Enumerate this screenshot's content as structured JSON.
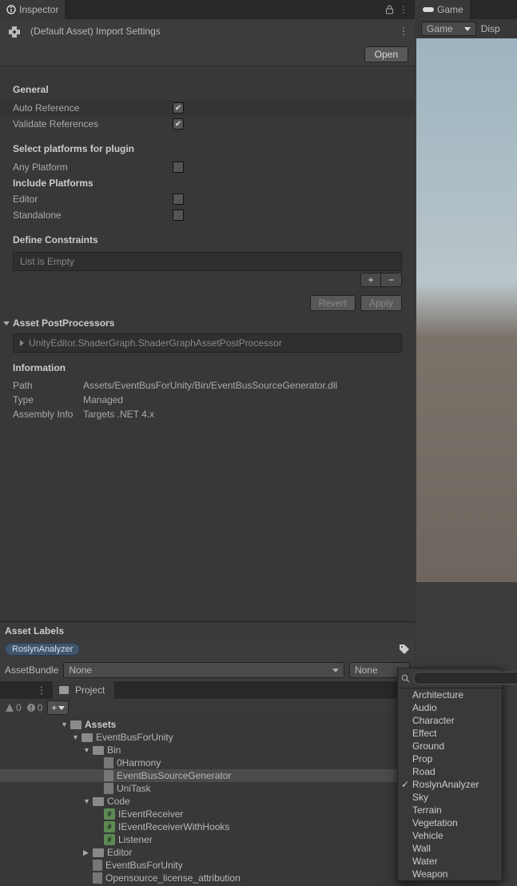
{
  "tabs": {
    "inspector": "Inspector",
    "game": "Game",
    "display": "Disp"
  },
  "header": {
    "title": "(Default Asset) Import Settings",
    "open": "Open"
  },
  "general": {
    "title": "General",
    "auto_ref": "Auto Reference",
    "validate": "Validate References"
  },
  "platforms": {
    "title": "Select platforms for plugin",
    "any": "Any Platform",
    "include": "Include Platforms",
    "editor": "Editor",
    "standalone": "Standalone"
  },
  "define": {
    "title": "Define Constraints",
    "empty": "List is Empty"
  },
  "actions": {
    "revert": "Revert",
    "apply": "Apply"
  },
  "post": {
    "title": "Asset PostProcessors",
    "item": "UnityEditor.ShaderGraph.ShaderGraphAssetPostProcessor"
  },
  "info": {
    "title": "Information",
    "path_k": "Path",
    "path_v": "Assets/EventBusForUnity/Bin/EventBusSourceGenerator.dll",
    "type_k": "Type",
    "type_v": "Managed",
    "asm_k": "Assembly Info",
    "asm_v": "Targets .NET 4.x"
  },
  "labels": {
    "title": "Asset Labels",
    "tag": "RoslynAnalyzer",
    "bundle": "AssetBundle",
    "none": "None"
  },
  "project": {
    "tab": "Project",
    "warn_count": "0",
    "err_count": "0",
    "tree": {
      "assets": "Assets",
      "ebfu": "EventBusForUnity",
      "bin": "Bin",
      "harmony": "0Harmony",
      "gen": "EventBusSourceGenerator",
      "unitask": "UniTask",
      "code": "Code",
      "recv": "IEventReceiver",
      "recvh": "IEventReceiverWithHooks",
      "listener": "Listener",
      "editor": "Editor",
      "ebfu2": "EventBusForUnity",
      "lic": "Opensource_license_attribution"
    }
  },
  "game": {
    "dd": "Game"
  },
  "popup": {
    "options": [
      "Architecture",
      "Audio",
      "Character",
      "Effect",
      "Ground",
      "Prop",
      "Road",
      "RoslynAnalyzer",
      "Sky",
      "Terrain",
      "Vegetation",
      "Vehicle",
      "Wall",
      "Water",
      "Weapon"
    ],
    "checked": "RoslynAnalyzer"
  }
}
